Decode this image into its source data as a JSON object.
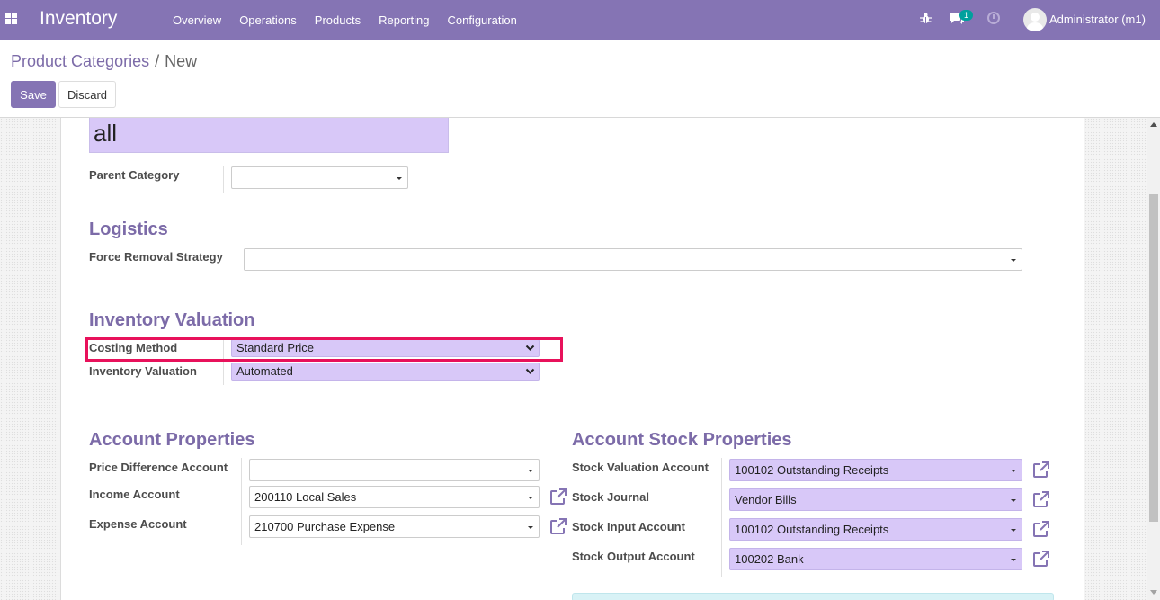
{
  "navbar": {
    "app_name": "Inventory",
    "menu": [
      "Overview",
      "Operations",
      "Products",
      "Reporting",
      "Configuration"
    ],
    "message_count": "1",
    "user": "Administrator (m1)",
    "icons": [
      "apps-grid-icon",
      "bug-icon",
      "chat-icon",
      "clock-icon",
      "avatar"
    ]
  },
  "breadcrumb": {
    "parent": "Product Categories",
    "current": "New"
  },
  "buttons": {
    "save": "Save",
    "discard": "Discard"
  },
  "form": {
    "name": "all",
    "parent_category": {
      "label": "Parent Category",
      "value": ""
    },
    "logistics": {
      "title": "Logistics",
      "force_removal_strategy": {
        "label": "Force Removal Strategy",
        "value": ""
      }
    },
    "inventory_valuation": {
      "title": "Inventory Valuation",
      "costing_method": {
        "label": "Costing Method",
        "value": "Standard Price"
      },
      "valuation": {
        "label": "Inventory Valuation",
        "value": "Automated"
      }
    },
    "account_properties": {
      "title": "Account Properties",
      "price_difference": {
        "label": "Price Difference Account",
        "value": ""
      },
      "income": {
        "label": "Income Account",
        "value": "200110 Local Sales"
      },
      "expense": {
        "label": "Expense Account",
        "value": "210700 Purchase Expense"
      }
    },
    "account_stock_properties": {
      "title": "Account Stock Properties",
      "stock_valuation": {
        "label": "Stock Valuation Account",
        "value": "100102 Outstanding Receipts"
      },
      "stock_journal": {
        "label": "Stock Journal",
        "value": "Vendor Bills"
      },
      "stock_input": {
        "label": "Stock Input Account",
        "value": "100102 Outstanding Receipts"
      },
      "stock_output": {
        "label": "Stock Output Account",
        "value": "100202 Bank"
      }
    }
  },
  "colors": {
    "brand": "#8574b4",
    "highlight": "#e8115b",
    "field_fill": "#d8c8f8"
  }
}
